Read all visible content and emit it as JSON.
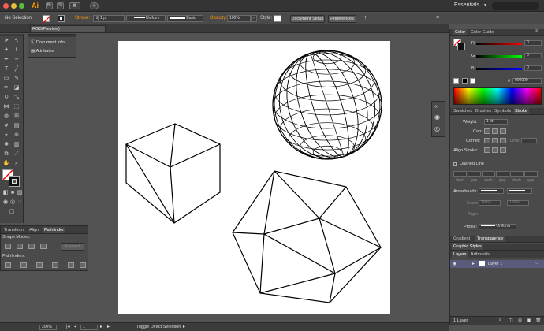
{
  "titlebar": {
    "app_icon": "Ai",
    "buttons": [
      "Br",
      "St"
    ],
    "workspace": "Essentials"
  },
  "control_bar": {
    "selection": "No Selection",
    "stroke_label": "Stroke:",
    "stroke_weight": "1 pt",
    "profile": "Uniform",
    "brush": "Basic",
    "opacity_label": "Opacity:",
    "opacity_value": "100%",
    "style_label": "Style:",
    "document_setup": "Document Setup",
    "preferences": "Preferences"
  },
  "document_tab": {
    "label": "RGB/Preview)"
  },
  "dock_panel": {
    "items": [
      "Document Info",
      "Attributes"
    ]
  },
  "pathfinder": {
    "tabs": [
      "Transform",
      "Align",
      "Pathfinder"
    ],
    "shape_modes": "Shape Modes:",
    "expand": "Expand",
    "pathfinders": "Pathfinders:"
  },
  "color_panel": {
    "tabs": [
      "Color",
      "Color Guide"
    ],
    "channels": [
      {
        "label": "R",
        "value": "0"
      },
      {
        "label": "G",
        "value": "0"
      },
      {
        "label": "B",
        "value": "0"
      }
    ],
    "hex": "000000"
  },
  "stroke_panel": {
    "tabs": [
      "Swatches",
      "Brushes",
      "Symbols",
      "Stroke"
    ],
    "weight_label": "Weight:",
    "weight_value": "1 pt",
    "cap_label": "Cap:",
    "corner_label": "Corner:",
    "limit_label": "Limit:",
    "align_label": "Align Stroke:",
    "dashed_line": "Dashed Line",
    "dash_labels": [
      "dash",
      "gap",
      "dash",
      "gap",
      "dash",
      "gap"
    ],
    "arrowheads_label": "Arrowheads:",
    "scale_label": "Scale:",
    "scale_values": [
      "100%",
      "100%"
    ],
    "align_label2": "Align:",
    "profile_label": "Profile:",
    "profile_value": "Uniform"
  },
  "gradient_panel": {
    "tabs": [
      "Gradient",
      "Transparency"
    ]
  },
  "graphic_styles": {
    "tabs": [
      "Graphic Styles"
    ]
  },
  "layers_panel": {
    "tabs": [
      "Layers",
      "Artboards"
    ],
    "layer_name": "Layer 1",
    "footer": "1 Layer"
  },
  "statusbar": {
    "zoom": "200%",
    "page": "1",
    "message": "Toggle Direct Selection"
  },
  "colors": {
    "accent": "#ff9a00",
    "red_slider": "#ff0000",
    "green_slider": "#00ff00",
    "blue_slider": "#0000ff"
  }
}
